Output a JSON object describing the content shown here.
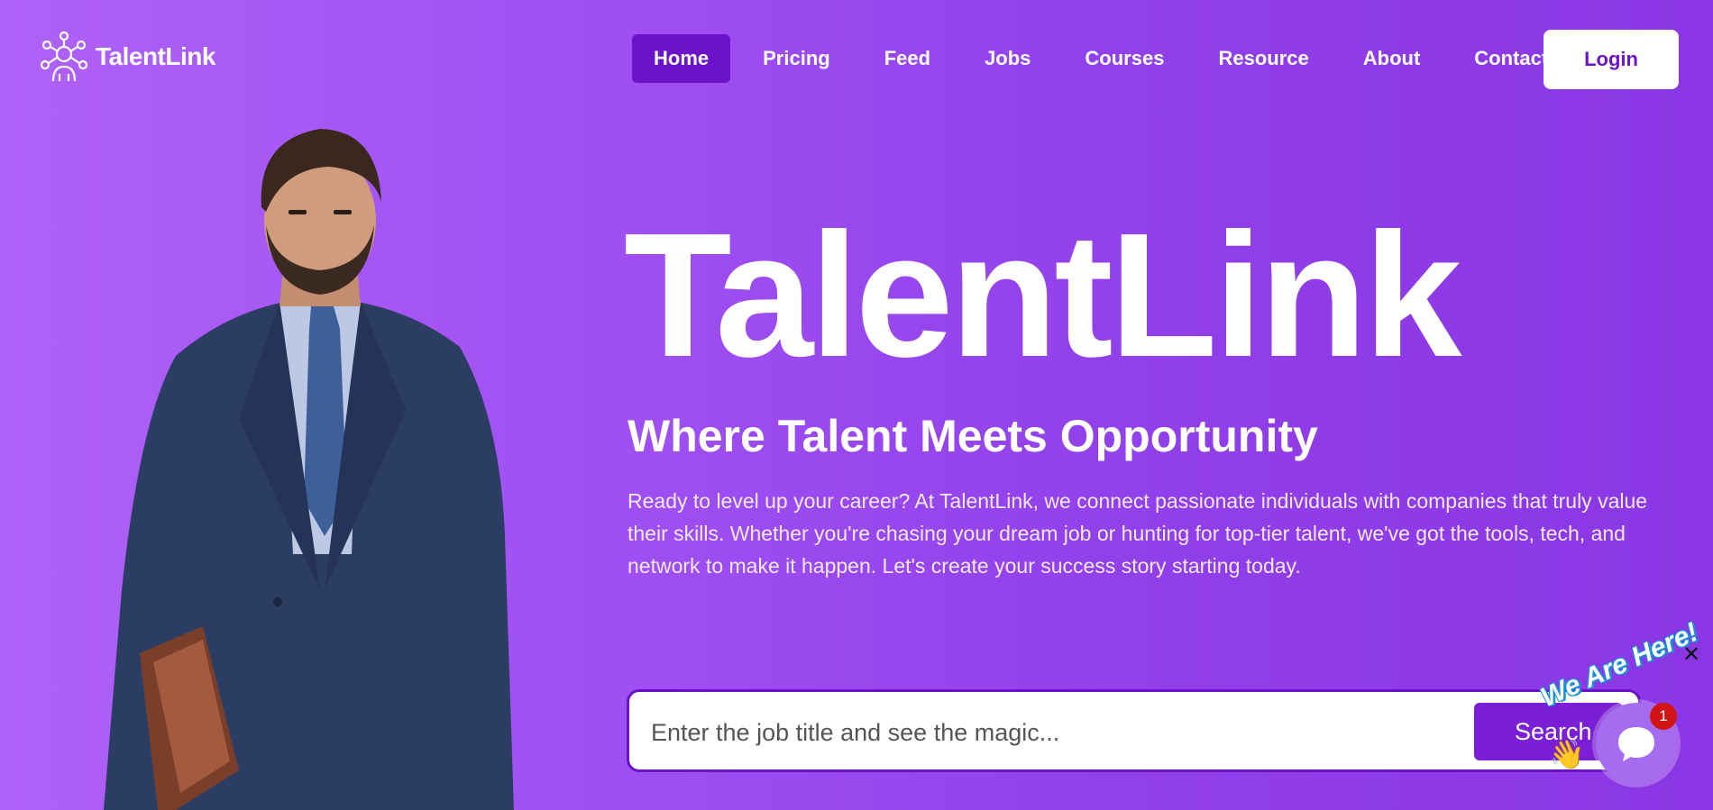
{
  "header": {
    "brand": "TalentLink",
    "nav": [
      {
        "label": "Home",
        "active": true
      },
      {
        "label": "Pricing"
      },
      {
        "label": "Feed"
      },
      {
        "label": "Jobs"
      },
      {
        "label": "Courses"
      },
      {
        "label": "Resource"
      },
      {
        "label": "About"
      },
      {
        "label": "Contact"
      }
    ],
    "login_label": "Login"
  },
  "hero": {
    "title": "TalentLink",
    "subtitle": "Where Talent Meets Opportunity",
    "description": "Ready to level up your career? At TalentLink, we connect passionate individuals with companies that truly value their skills. Whether you're chasing your dream job or hunting for top-tier talent, we've got the tools, tech, and network to make it happen. Let's create your success story starting today."
  },
  "search": {
    "placeholder": "Enter the job title and see the magic...",
    "button_label": "Search"
  },
  "chat_widget": {
    "banner": "We Are Here!",
    "badge_count": "1",
    "close_icon": "close-icon"
  },
  "colors": {
    "bg_start": "#b061f7",
    "bg_end": "#8a36e4",
    "nav_active": "#6c12c8",
    "accent": "#7a1fd6"
  }
}
